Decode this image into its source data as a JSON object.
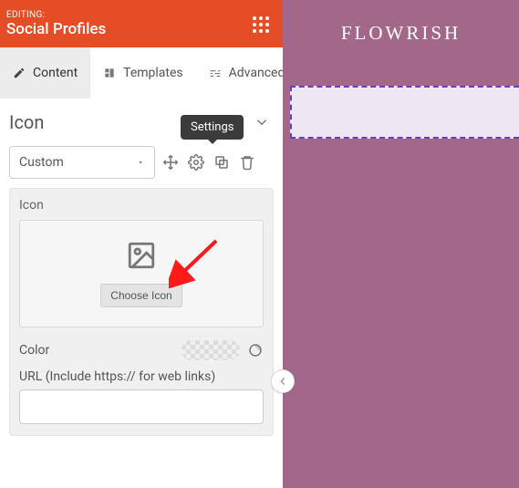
{
  "header": {
    "editing_label": "EDITING:",
    "title": "Social Profiles"
  },
  "tabs": {
    "items": [
      {
        "label": "Content"
      },
      {
        "label": "Templates"
      },
      {
        "label": "Advanced"
      }
    ]
  },
  "section": {
    "title": "Icon"
  },
  "select": {
    "value": "Custom"
  },
  "tooltip": {
    "settings": "Settings"
  },
  "card": {
    "label": "Icon",
    "choose_label": "Choose Icon",
    "color_label": "Color",
    "url_label": "URL (Include https:// for web links)",
    "url_value": ""
  },
  "brand": "FLOWRISH"
}
